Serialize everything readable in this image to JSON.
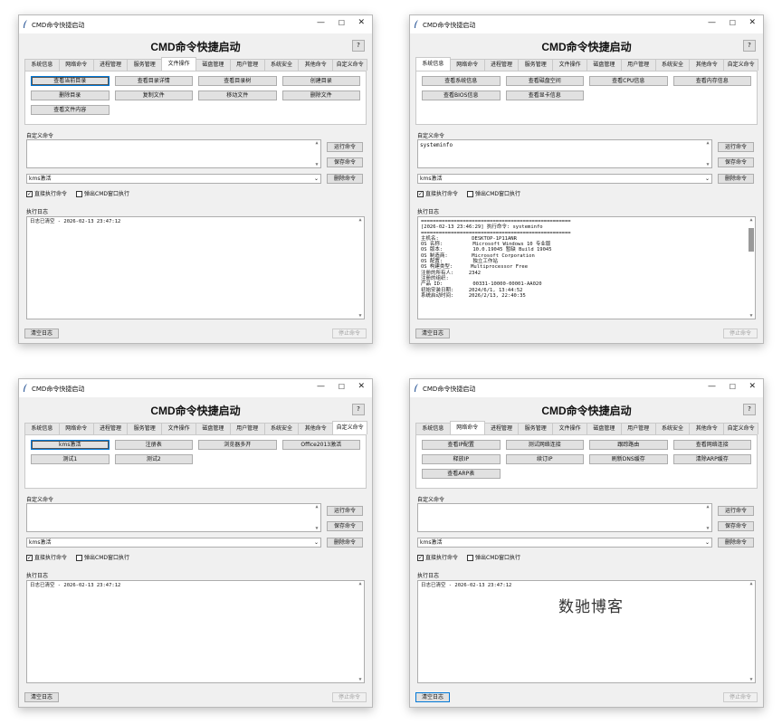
{
  "window_title": "CMD命令快捷启动",
  "window_controls": {
    "minimize": "—",
    "maximize": "☐",
    "close": "✕"
  },
  "app_title": "CMD命令快捷启动",
  "help_label": "?",
  "tabs": [
    "系统信息",
    "网络命令",
    "进程管理",
    "服务管理",
    "文件操作",
    "磁盘管理",
    "用户管理",
    "系统安全",
    "其他命令",
    "自定义命令"
  ],
  "custom_section_label": "自定义命令",
  "log_section_label": "执行日志",
  "run_label": "运行命令",
  "save_label": "保存命令",
  "delete_label": "删除命令",
  "clear_log_label": "清空日志",
  "stop_label": "停止命令",
  "combo_value": "kms激活",
  "check_direct_label": "直接执行命令",
  "check_popup_label": "弹出CMD窗口执行",
  "check_mark": "✓",
  "scroll_up": "▲",
  "scroll_down": "▼",
  "combo_arrow": "⌄",
  "windows": [
    {
      "active_tab": 4,
      "selected_button": 0,
      "buttons": [
        "查看当前目录",
        "查看目录详情",
        "查看目录树",
        "创建目录",
        "删除目录",
        "复制文件",
        "移动文件",
        "删除文件",
        "查看文件内容"
      ],
      "command_text": "",
      "log_lines": [
        "日志已清空 - 2026-02-13 23:47:12"
      ],
      "log_scrollbar": false,
      "clear_focused": false
    },
    {
      "active_tab": 0,
      "selected_button": -1,
      "buttons": [
        "查看系统信息",
        "查看磁盘空间",
        "查看CPU信息",
        "查看内存信息",
        "查看BIOS信息",
        "查看显卡信息"
      ],
      "command_text": "systeminfo",
      "log_lines": [
        "==================================================",
        "[2026-02-13 23:46:29] 执行命令: systeminfo",
        "==================================================",
        "",
        "主机名:           DESKTOP-1P11ANR",
        "OS 名称:          Microsoft Windows 10 专业版",
        "OS 版本:          10.0.19045 暂缺 Build 19045",
        "OS 制造商:        Microsoft Corporation",
        "OS 配置:          独立工作站",
        "OS 构建类型:      Multiprocessor Free",
        "注册的所有人:     2342",
        "注册的组织:",
        "产品 ID:          00331-10000-00001-AA020",
        "初始安装日期:     2024/6/1, 13:44:52",
        "系统启动时间:     2026/2/13, 22:40:35"
      ],
      "log_scrollbar": true,
      "clear_focused": false
    },
    {
      "active_tab": 9,
      "selected_button": 0,
      "buttons": [
        "kms激活",
        "注册表",
        "浏览器多开",
        "Office2013激活",
        "测试1",
        "测试2"
      ],
      "command_text": "",
      "log_lines": [
        "日志已清空 - 2026-02-13 23:47:12"
      ],
      "log_scrollbar": false,
      "clear_focused": false
    },
    {
      "active_tab": 1,
      "selected_button": -1,
      "buttons": [
        "查看IP配置",
        "测试网络连接",
        "跟踪路由",
        "查看网络连接",
        "释放IP",
        "续订IP",
        "刷新DNS缓存",
        "清除ARP缓存",
        "查看ARP表"
      ],
      "command_text": "",
      "log_lines": [
        "日志已清空 - 2026-02-13 23:47:12"
      ],
      "log_scrollbar": false,
      "clear_focused": true
    }
  ],
  "watermark": "数驰博客"
}
